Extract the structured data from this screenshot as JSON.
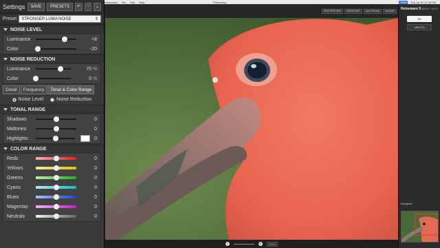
{
  "menubar": {
    "items": [
      "Noiseware",
      "File",
      "Edit",
      "Help"
    ],
    "app_title": "Photoshop",
    "status_badge": "7999",
    "clock": "Thu Jul 30 12:28 PM"
  },
  "panel": {
    "title": "Settings",
    "save_label": "SAVE",
    "presets_label": "PRESETS",
    "preset_label": "Preset",
    "preset_value": "STRONGER LUMA NOISE"
  },
  "noise_level": {
    "heading": "NOISE LEVEL",
    "rows": [
      {
        "label": "Luminance",
        "value": "+8",
        "level": 0.72
      },
      {
        "label": "Color",
        "value": "-20",
        "level": 0.05
      }
    ]
  },
  "noise_reduction": {
    "heading": "NOISE REDUCTION",
    "rows": [
      {
        "label": "Luminance",
        "value": "70",
        "unit": "%",
        "level": 0.7
      },
      {
        "label": "Color",
        "value": "0",
        "unit": "%",
        "level": 0.0
      }
    ]
  },
  "tabs": [
    "Detail",
    "Frequency",
    "Tonal & Color Range"
  ],
  "active_tab": 2,
  "radios": [
    {
      "label": "Noise Level",
      "selected": true
    },
    {
      "label": "Noise Reduction",
      "selected": false
    }
  ],
  "tonal_range": {
    "heading": "TONAL RANGE",
    "rows": [
      {
        "label": "Shadows",
        "value": "0",
        "level": 0.5
      },
      {
        "label": "Midtones",
        "value": "0",
        "level": 0.5
      },
      {
        "label": "Highlights",
        "value": "0",
        "level": 0.5
      }
    ]
  },
  "color_range": {
    "heading": "COLOR RANGE",
    "rows": [
      {
        "label": "Reds",
        "value": "0",
        "level": 0.5,
        "gradient": [
          "#f0b0b0",
          "#e02020"
        ]
      },
      {
        "label": "Yellows",
        "value": "0",
        "level": 0.5,
        "gradient": [
          "#f4e8a0",
          "#e0c010"
        ]
      },
      {
        "label": "Greens",
        "value": "0",
        "level": 0.5,
        "gradient": [
          "#b8eeb0",
          "#20b020"
        ]
      },
      {
        "label": "Cyans",
        "value": "0",
        "level": 0.5,
        "gradient": [
          "#b0eeee",
          "#10b8c8"
        ]
      },
      {
        "label": "Blues",
        "value": "0",
        "level": 0.5,
        "gradient": [
          "#b0c0f0",
          "#2040d0"
        ]
      },
      {
        "label": "Magentas",
        "value": "0",
        "level": 0.5,
        "gradient": [
          "#f0b0f0",
          "#c020c0"
        ]
      },
      {
        "label": "Neutrals",
        "value": "0",
        "level": 0.5,
        "gradient": [
          "#f0f0f0",
          "#666666"
        ]
      }
    ]
  },
  "viewer": {
    "toolbar": [
      "SIDE PREVIEW",
      "NOISE MAP",
      "Dust Preview",
      "Accurate"
    ],
    "zoom": "100%"
  },
  "right_panel": {
    "title": "Noiseware 5",
    "about_label": "ABOUT / HELP",
    "ok_label": "OK",
    "cancel_label": "CANCEL",
    "navigator_label": "Navigator"
  }
}
